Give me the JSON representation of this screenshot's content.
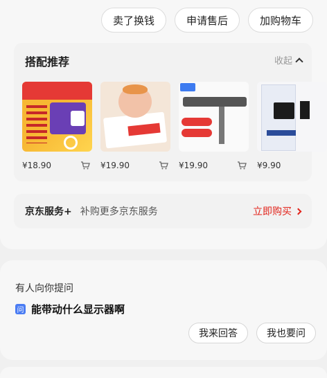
{
  "top_actions": {
    "sell": "卖了换钱",
    "after_sale": "申请售后",
    "add_cart": "加购物车"
  },
  "recommend": {
    "title": "搭配推荐",
    "collapse_label": "收起",
    "collapse_icon": "chevron-up-icon",
    "products": [
      {
        "price": "¥18.90",
        "cart_icon": "cart-icon"
      },
      {
        "price": "¥19.90",
        "cart_icon": "cart-icon"
      },
      {
        "price": "¥19.90",
        "cart_icon": "cart-icon"
      },
      {
        "price": "¥9.90",
        "cart_icon": "cart-icon"
      }
    ]
  },
  "jd_service": {
    "title": "京东服务+",
    "desc": "补购更多京东服务",
    "buy": "立即购买",
    "accent": "#e2231a"
  },
  "qa": {
    "title": "有人向你提问",
    "question_icon": "问",
    "question": "能带动什么显示器啊",
    "answer_button": "我来回答",
    "ask_button": "我也要问",
    "accent": "#4a7cf3"
  }
}
